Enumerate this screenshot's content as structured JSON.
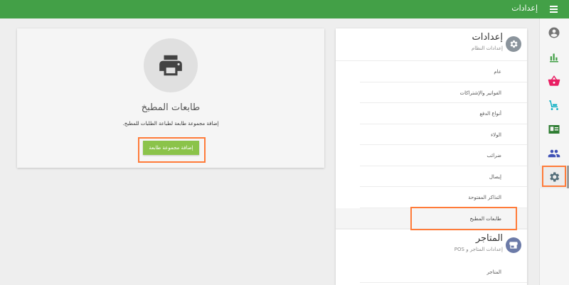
{
  "header": {
    "title": "إعدادات",
    "menu_icon": "hamburger-menu-icon",
    "background": "#43a047"
  },
  "rail": {
    "items": [
      {
        "name": "account",
        "icon": "account-circle-icon",
        "color": "#757575"
      },
      {
        "name": "reports",
        "icon": "bar-chart-icon",
        "color": "#43a047"
      },
      {
        "name": "orders",
        "icon": "basket-icon",
        "color": "#e91e63"
      },
      {
        "name": "delivery",
        "icon": "delivery-cart-icon",
        "color": "#00acc1"
      },
      {
        "name": "customers",
        "icon": "contact-card-icon",
        "color": "#2e7d32"
      },
      {
        "name": "employees",
        "icon": "people-icon",
        "color": "#3f51b5"
      },
      {
        "name": "settings",
        "icon": "gear-icon",
        "color": "#546e7a",
        "active": true
      }
    ]
  },
  "settings_panel": {
    "title": "إعدادات",
    "subtitle": "إعدادات النظام",
    "items": [
      {
        "label": "عام"
      },
      {
        "label": "الفواتير والإشتراكات"
      },
      {
        "label": "أنواع الدفع"
      },
      {
        "label": "الولاء"
      },
      {
        "label": "ضرائب"
      },
      {
        "label": "إيصال"
      },
      {
        "label": "التذاكر المفتوحة"
      },
      {
        "label": "طابعات المطبخ",
        "selected": true
      }
    ],
    "section2": {
      "title": "المتاجر",
      "subtitle": "إعدادات المتاجر و POS",
      "items": [
        {
          "label": "المتاجر"
        }
      ]
    }
  },
  "printers": {
    "title": "طابعات المطبخ",
    "description": "إضافة مجموعة طابعة لطباعة الطلبات للمطبخ.",
    "add_button": "إضافة مجموعة طابعة",
    "button_color": "#8bc34a",
    "icon": "printer-icon"
  },
  "highlight_color": "#ff7b39"
}
